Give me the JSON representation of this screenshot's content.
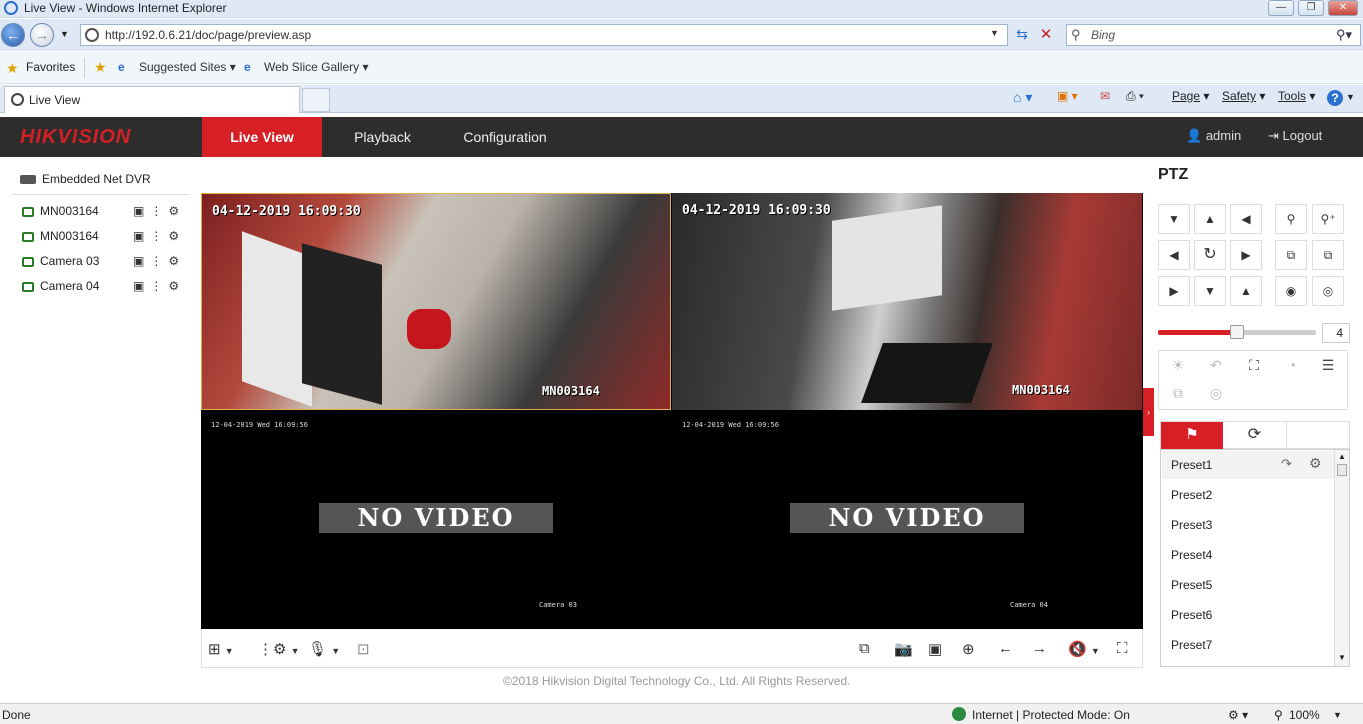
{
  "window": {
    "title": "Live View - Windows Internet Explorer"
  },
  "address": {
    "url": "http://192.0.6.21/doc/page/preview.asp"
  },
  "search": {
    "placeholder": "Bing"
  },
  "favorites": {
    "favorites_label": "Favorites",
    "suggested_sites": "Suggested Sites",
    "web_slice": "Web Slice Gallery"
  },
  "tab": {
    "label": "Live View"
  },
  "commandbar": {
    "page": "Page",
    "safety": "Safety",
    "tools": "Tools"
  },
  "app": {
    "brand": "HIKVISION",
    "nav": {
      "live_view": "Live View",
      "playback": "Playback",
      "configuration": "Configuration"
    },
    "user": "admin",
    "logout": "Logout",
    "accent_color": "#d71f26"
  },
  "device_tree": {
    "root": "Embedded Net DVR",
    "cameras": [
      "MN003164",
      "MN003164",
      "Camera 03",
      "Camera 04"
    ]
  },
  "video": {
    "tile1": {
      "timestamp": "04-12-2019 16:09:30",
      "name": "MN003164"
    },
    "tile2": {
      "timestamp": "04-12-2019 16:09:30",
      "name": "MN003164"
    },
    "tile3": {
      "timestamp": "12-04-2019 Wed 16:09:56",
      "name": "Camera 03",
      "message": "NO VIDEO"
    },
    "tile4": {
      "timestamp": "12-04-2019 Wed 16:09:56",
      "name": "Camera 04",
      "message": "NO VIDEO"
    }
  },
  "footer": {
    "copyright": "©2018 Hikvision Digital Technology Co., Ltd. All Rights Reserved."
  },
  "ptz": {
    "title": "PTZ",
    "speed": "4",
    "presets": [
      "Preset1",
      "Preset2",
      "Preset3",
      "Preset4",
      "Preset5",
      "Preset6",
      "Preset7"
    ]
  },
  "statusbar": {
    "status": "Done",
    "zone": "Internet | Protected Mode: On",
    "zoom": "100%"
  }
}
